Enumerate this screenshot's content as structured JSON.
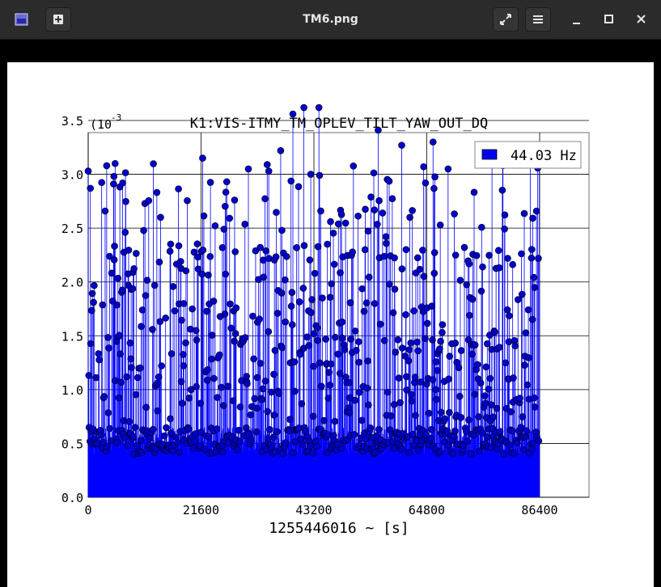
{
  "window": {
    "title": "TM6.png",
    "buttons": {
      "app": "image-viewer-icon",
      "new": "new-tab-icon",
      "fullscreen": "fullscreen-icon",
      "menu": "hamburger-menu-icon",
      "minimize": "minimize-icon",
      "maximize": "maximize-icon",
      "close": "close-icon"
    }
  },
  "colors": {
    "titlebar": "#2b2b2b",
    "series": "#0000ff",
    "marker": "#0000cc"
  },
  "chart_data": {
    "type": "scatter",
    "style": "stem",
    "title": "K1:VIS-ITMY_TM_OPLEV_TILT_YAW_OUT_DQ",
    "xlabel": "1255446016 ~ [s]",
    "ylabel": "",
    "y_exponent_label": "(10",
    "y_exponent_power": "-3",
    "xlim": [
      0,
      86400
    ],
    "ylim": [
      0,
      3.6
    ],
    "x_ticks": [
      0,
      21600,
      43200,
      64800,
      86400
    ],
    "x_tick_labels": [
      "0",
      "21600",
      "43200",
      "64800",
      "86400"
    ],
    "y_ticks": [
      0,
      0.5,
      1,
      1.5,
      2,
      2.5,
      3,
      3.5
    ],
    "y_tick_labels": [
      "0.0",
      "0.5",
      "1.0",
      "1.5",
      "2.0",
      "2.5",
      "3.0",
      "3.5"
    ],
    "grid": true,
    "legend": {
      "position": "top-right",
      "entries": [
        "44.03 Hz"
      ]
    },
    "series": [
      {
        "name": "44.03 Hz",
        "dt": 60,
        "x_start": 0,
        "x_end": 86340,
        "values_summary": "1440 points, mostly 0.4-0.65 with frequent spikes to 1.0-3.6",
        "peaks": [
          {
            "x": 0,
            "y": 3.03
          },
          {
            "x": 3540,
            "y": 3.08
          },
          {
            "x": 5160,
            "y": 3.1
          },
          {
            "x": 21900,
            "y": 3.15
          },
          {
            "x": 30660,
            "y": 3.05
          },
          {
            "x": 34260,
            "y": 3.09
          },
          {
            "x": 36840,
            "y": 3.22
          },
          {
            "x": 39180,
            "y": 3.56
          },
          {
            "x": 41280,
            "y": 3.62
          },
          {
            "x": 42600,
            "y": 3.0
          },
          {
            "x": 44160,
            "y": 3.62
          },
          {
            "x": 55500,
            "y": 3.41
          },
          {
            "x": 60000,
            "y": 3.27
          },
          {
            "x": 64200,
            "y": 3.07
          },
          {
            "x": 66000,
            "y": 3.3
          },
          {
            "x": 68880,
            "y": 3.05
          },
          {
            "x": 77280,
            "y": 3.1
          },
          {
            "x": 79320,
            "y": 3.17
          },
          {
            "x": 84600,
            "y": 3.12
          },
          {
            "x": 86340,
            "y": 3.24
          }
        ]
      }
    ]
  }
}
